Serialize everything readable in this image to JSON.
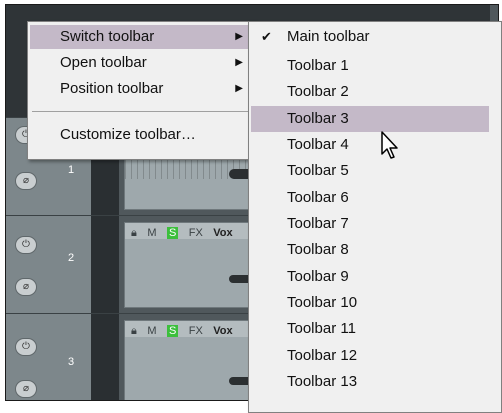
{
  "tracks": [
    {
      "number": "1"
    },
    {
      "number": "2",
      "item_label": "Vox"
    },
    {
      "number": "3",
      "item_label": "Vox"
    }
  ],
  "item_header_icons": {
    "mute": "M",
    "fx": "FX"
  },
  "menu": {
    "items": [
      {
        "label": "Switch toolbar",
        "has_submenu": true,
        "highlighted": true
      },
      {
        "label": "Open toolbar",
        "has_submenu": true
      },
      {
        "label": "Position toolbar",
        "has_submenu": true
      },
      {
        "label": "Customize toolbar…",
        "has_submenu": false
      }
    ]
  },
  "submenu": {
    "items": [
      {
        "label": "Main toolbar",
        "checked": true
      },
      {
        "label": "Toolbar 1"
      },
      {
        "label": "Toolbar 2"
      },
      {
        "label": "Toolbar 3",
        "highlighted": true
      },
      {
        "label": "Toolbar 4"
      },
      {
        "label": "Toolbar 5"
      },
      {
        "label": "Toolbar 6"
      },
      {
        "label": "Toolbar 7"
      },
      {
        "label": "Toolbar 8"
      },
      {
        "label": "Toolbar 9"
      },
      {
        "label": "Toolbar 10"
      },
      {
        "label": "Toolbar 11"
      },
      {
        "label": "Toolbar 12"
      },
      {
        "label": "Toolbar 13"
      }
    ]
  },
  "glyphs": {
    "submenu_arrow": "▶",
    "check": "✔"
  },
  "colors": {
    "highlight": "#c4b9c8",
    "menu_bg": "#f0f0f0",
    "fx_icon": "#3cbf3c"
  }
}
